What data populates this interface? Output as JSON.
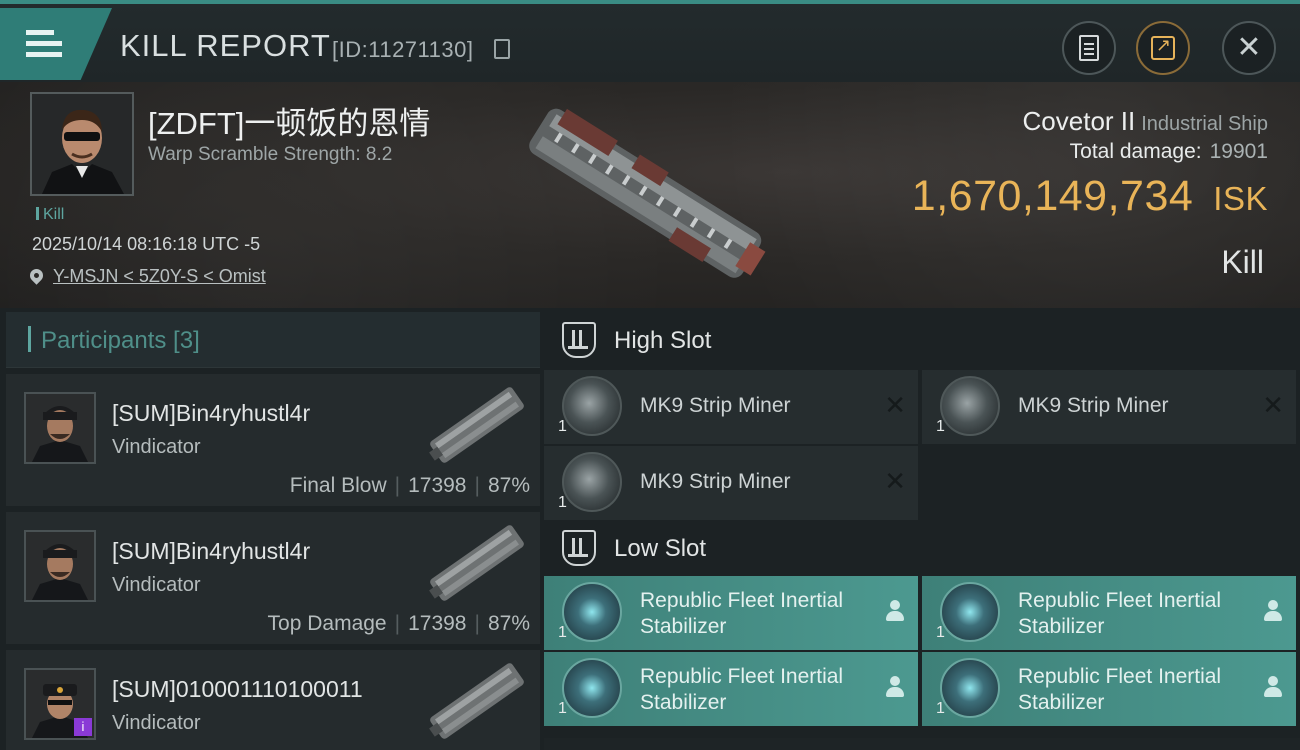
{
  "header": {
    "title": "KILL REPORT",
    "id_label": "[ID:11271130]"
  },
  "victim": {
    "name": "[ZDFT]一顿饭的恩情",
    "warp_scramble": "Warp Scramble Strength: 8.2",
    "kill_tag": "Kill",
    "datetime": "2025/10/14 08:16:18 UTC -5",
    "location": "Y-MSJN < 5Z0Y-S < Omist"
  },
  "ship": {
    "name": "Covetor II",
    "class": "Industrial Ship",
    "total_damage_label": "Total damage:",
    "total_damage": "19901",
    "isk_value": "1,670,149,734",
    "isk_unit": "ISK",
    "result": "Kill"
  },
  "participants": {
    "header": "Participants [3]",
    "rows": [
      {
        "name": "[SUM]Bin4ryhustl4r",
        "ship": "Vindicator",
        "role": "Final Blow",
        "damage": "17398",
        "percent": "87%"
      },
      {
        "name": "[SUM]Bin4ryhustl4r",
        "ship": "Vindicator",
        "role": "Top Damage",
        "damage": "17398",
        "percent": "87%"
      },
      {
        "name": "[SUM]010001110100011",
        "ship": "Vindicator",
        "badge": "i"
      }
    ]
  },
  "fitting": {
    "high_slot": {
      "title": "High Slot",
      "modules": [
        {
          "name": "MK9 Strip Miner",
          "qty": "1"
        },
        {
          "name": "MK9 Strip Miner",
          "qty": "1"
        },
        {
          "name": "MK9 Strip Miner",
          "qty": "1"
        }
      ]
    },
    "low_slot": {
      "title": "Low Slot",
      "modules": [
        {
          "name": "Republic Fleet Inertial Stabilizer",
          "qty": "1"
        },
        {
          "name": "Republic Fleet Inertial Stabilizer",
          "qty": "1"
        },
        {
          "name": "Republic Fleet Inertial Stabilizer",
          "qty": "1"
        },
        {
          "name": "Republic Fleet Inertial Stabilizer",
          "qty": "1"
        }
      ]
    }
  },
  "icons": {
    "menu": "menu-icon",
    "copy": "copy-icon",
    "doc": "document-icon",
    "share": "share-icon",
    "close": "close-icon",
    "pin": "location-pin-icon",
    "slot": "slot-icon",
    "destroyed": "destroyed-x-icon",
    "dropped": "person-icon"
  },
  "colors": {
    "accent": "#3a8c84",
    "isk": "#e9b458",
    "dropped_module": "#4c9990"
  }
}
